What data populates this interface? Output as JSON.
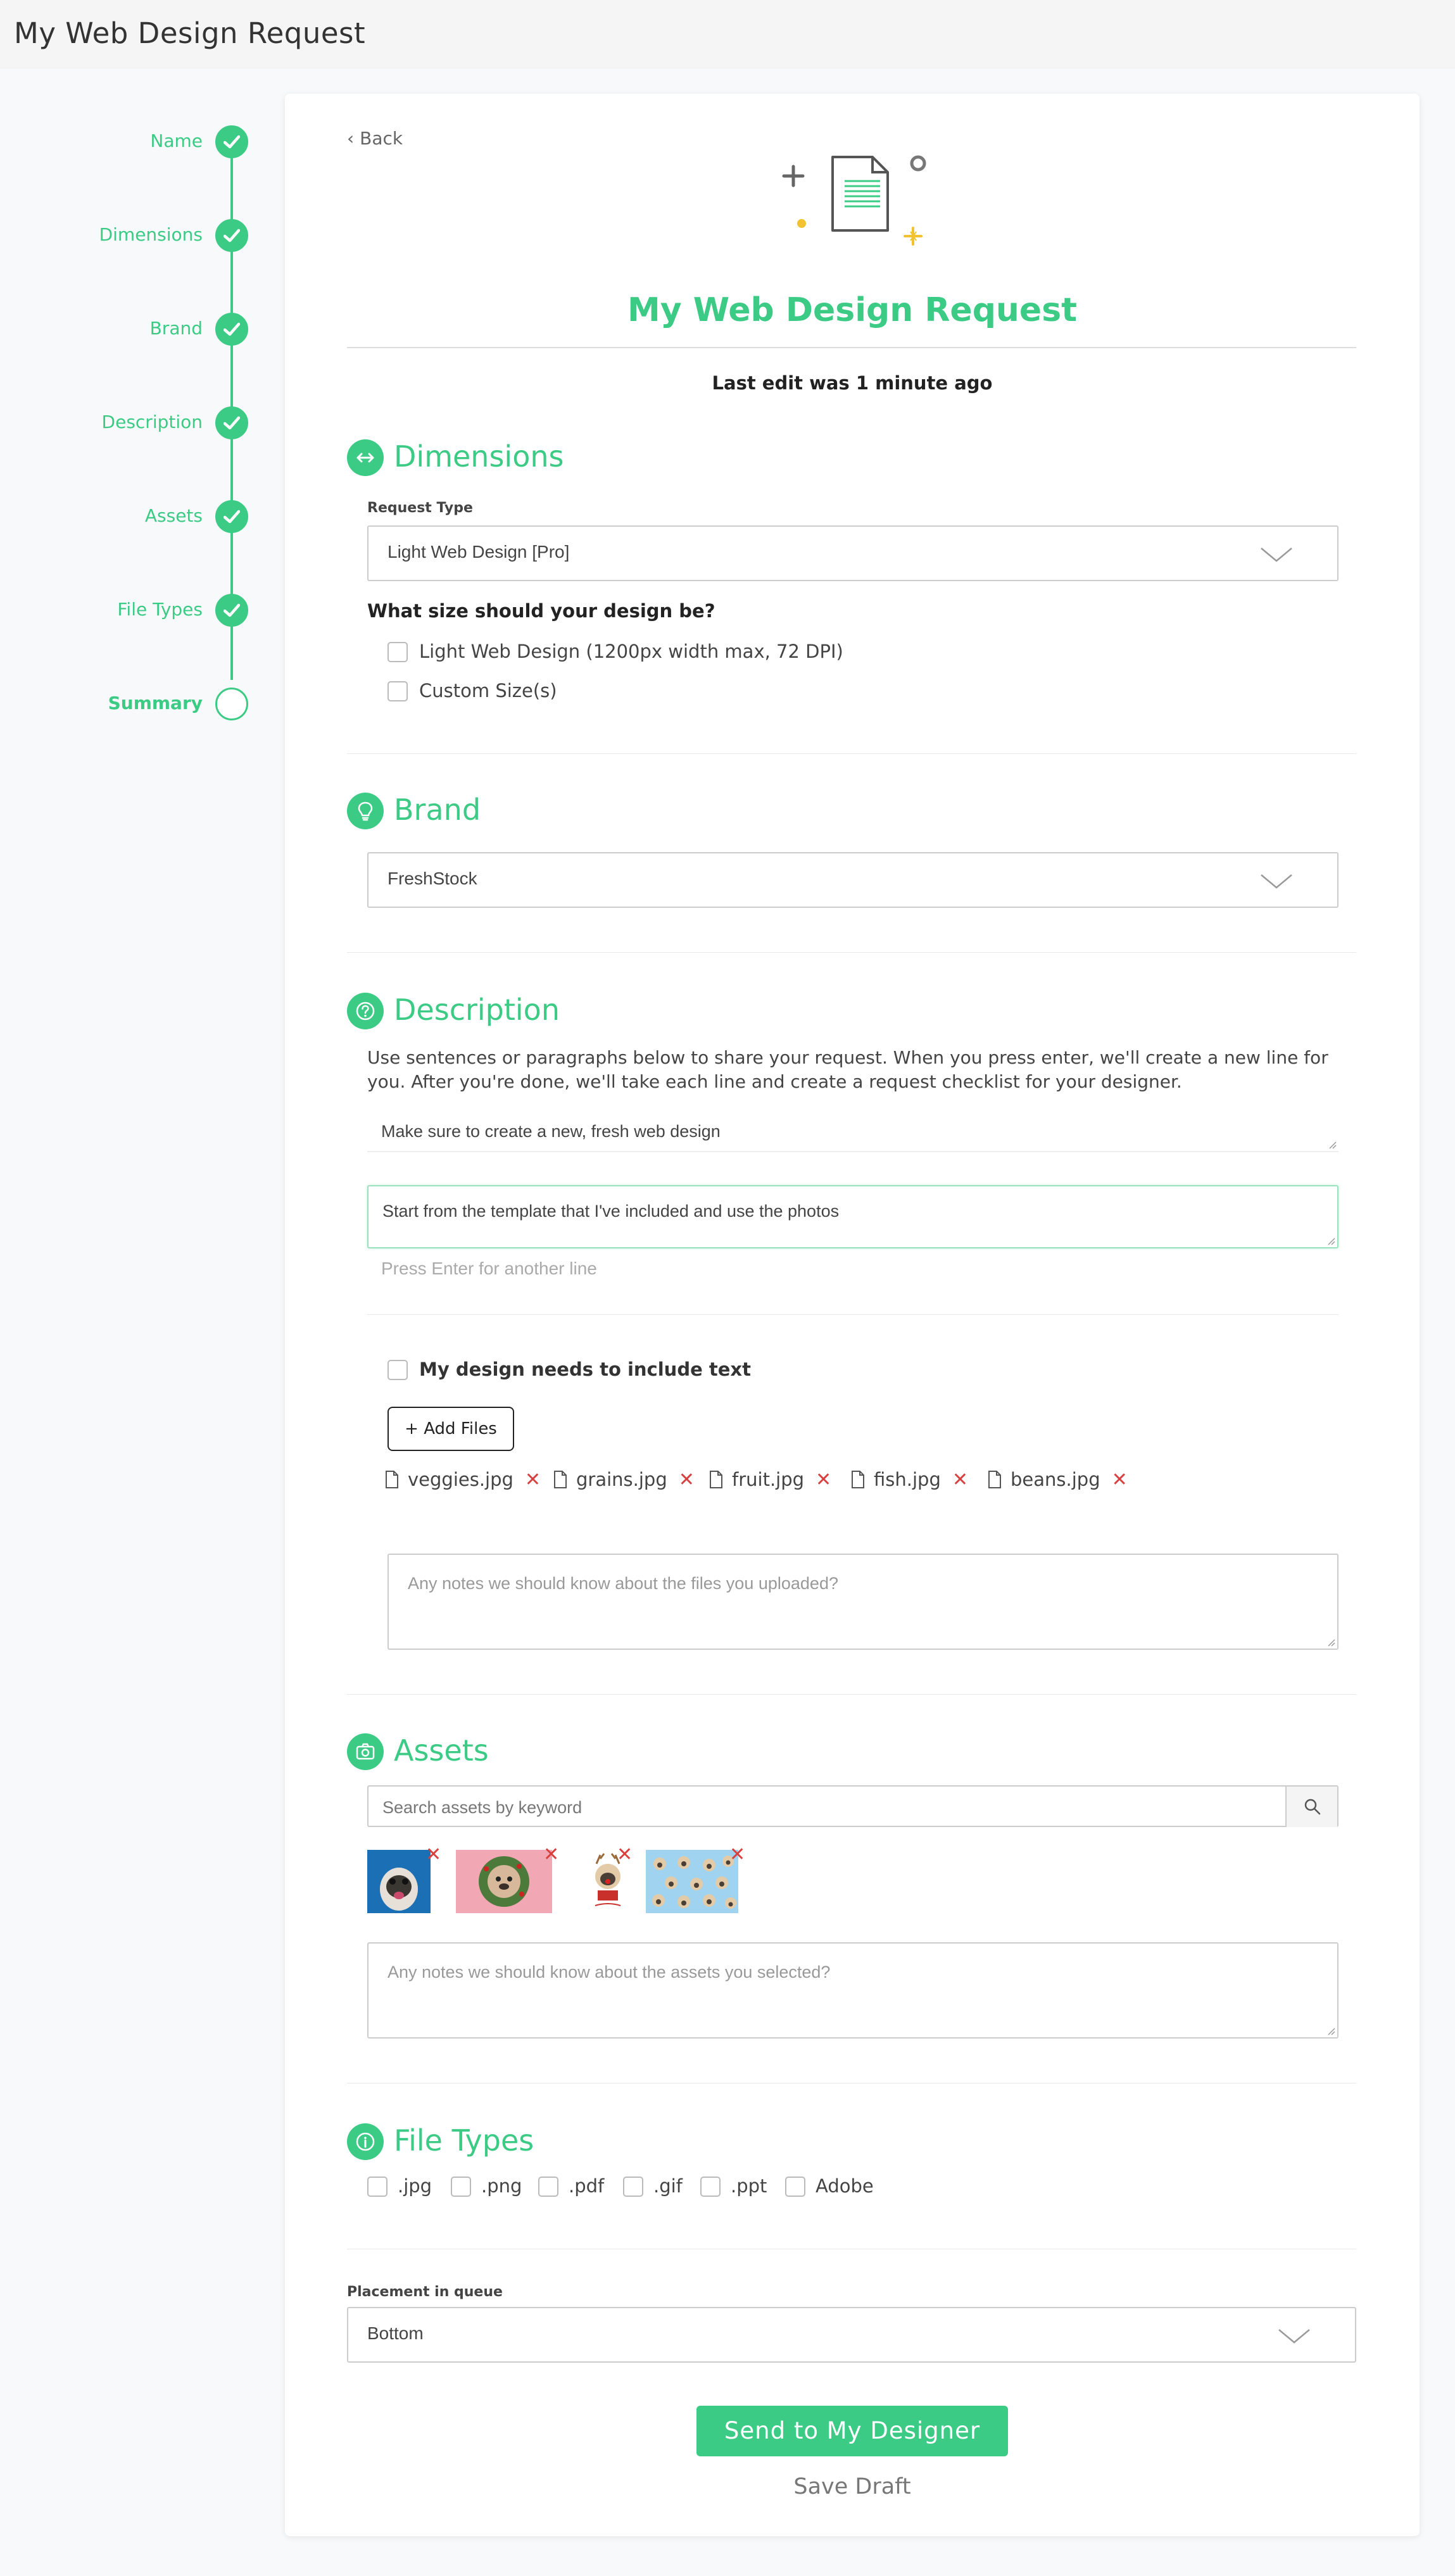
{
  "page": {
    "title": "My Web Design Request"
  },
  "stepper": {
    "steps": [
      {
        "label": "Name",
        "done": true
      },
      {
        "label": "Dimensions",
        "done": true
      },
      {
        "label": "Brand",
        "done": true
      },
      {
        "label": "Description",
        "done": true
      },
      {
        "label": "Assets",
        "done": true
      },
      {
        "label": "File Types",
        "done": true
      },
      {
        "label": "Summary",
        "done": false
      }
    ]
  },
  "card": {
    "back_label": "Back",
    "title": "My Web Design Request",
    "last_edit": "Last edit was 1 minute ago"
  },
  "dimensions": {
    "title": "Dimensions",
    "icon": "arrows-horizontal-icon",
    "request_type_label": "Request Type",
    "request_type_value": "Light Web Design [Pro]",
    "size_question": "What size should your design be?",
    "size_options": [
      {
        "label": "Light Web Design (1200px width max, 72 DPI)",
        "checked": false
      },
      {
        "label": "Custom Size(s)",
        "checked": false
      }
    ]
  },
  "brand": {
    "title": "Brand",
    "icon": "lightbulb-icon",
    "value": "FreshStock"
  },
  "description": {
    "title": "Description",
    "icon": "question-icon",
    "intro": "Use sentences or paragraphs below to share your request. When you press enter, we'll create a new line for you. After you're done, we'll take each line and create a request checklist for your designer.",
    "lines": [
      "Make sure to create a new, fresh web design",
      "Start from the template that I've included and use the photos"
    ],
    "next_placeholder": "Press Enter for another line",
    "include_text_label": "My design needs to include text",
    "add_files_label": "Add Files",
    "files": [
      "veggies.jpg",
      "grains.jpg",
      "fruit.jpg",
      "fish.jpg",
      "beans.jpg"
    ],
    "files_notes_placeholder": "Any notes we should know about the files you uploaded?"
  },
  "assets": {
    "title": "Assets",
    "icon": "camera-icon",
    "search_placeholder": "Search assets by keyword",
    "notes_placeholder": "Any notes we should know about the assets you selected?"
  },
  "file_types": {
    "title": "File Types",
    "icon": "info-icon",
    "options": [
      ".jpg",
      ".png",
      ".pdf",
      ".gif",
      ".ppt",
      "Adobe"
    ]
  },
  "queue": {
    "label": "Placement in queue",
    "value": "Bottom"
  },
  "actions": {
    "send_label": "Send to My Designer",
    "save_draft_label": "Save Draft"
  },
  "colors": {
    "accent": "#3ccb85",
    "remove": "#d94040"
  }
}
